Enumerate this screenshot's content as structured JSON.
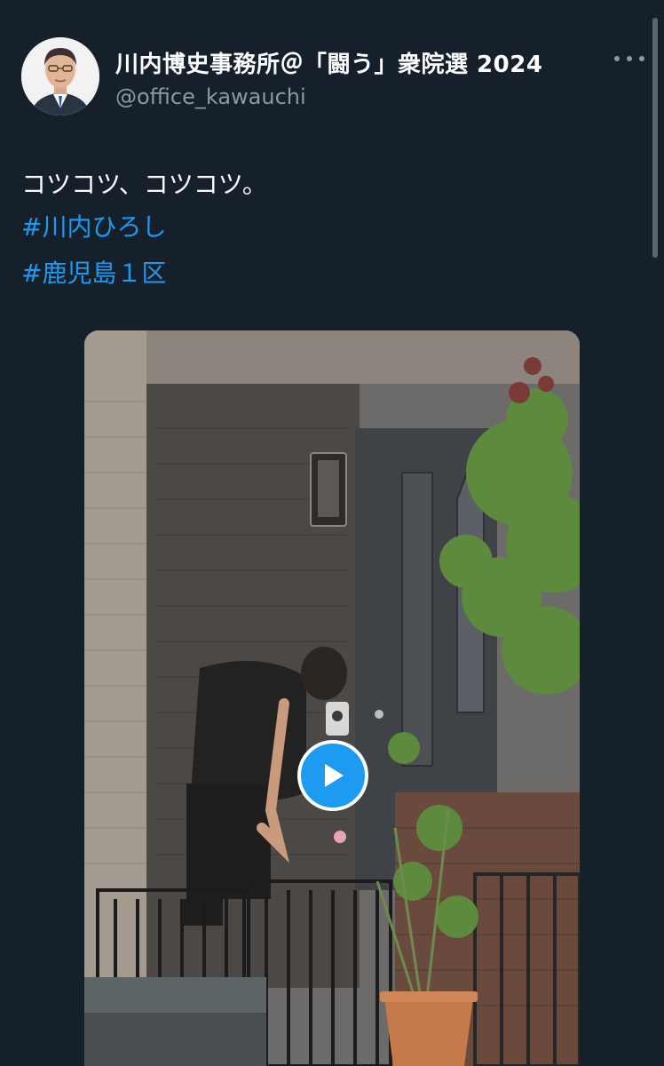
{
  "author": {
    "display_name": "川内博史事務所＠「闘う」衆院選 2024",
    "handle": "@office_kawauchi"
  },
  "tweet": {
    "text": "コツコツ、コツコツ。",
    "hashtags": [
      "#川内ひろし",
      "#鹿児島１区"
    ]
  },
  "media": {
    "type": "video",
    "play_icon": "play-icon"
  },
  "icons": {
    "more": "more-options-icon"
  },
  "colors": {
    "background": "#15202b",
    "link": "#1d9bf0",
    "secondary_text": "#8b98a5"
  }
}
